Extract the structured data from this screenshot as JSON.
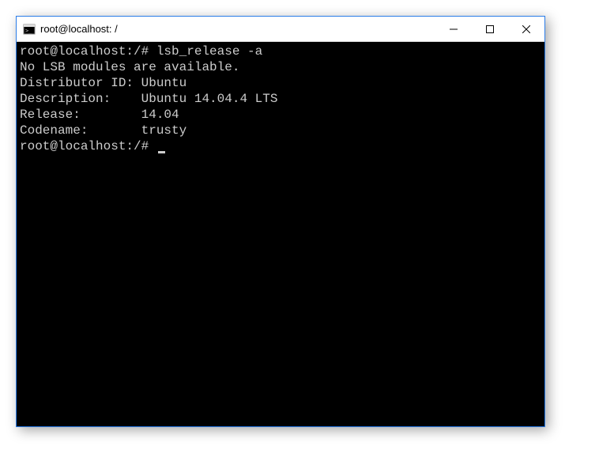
{
  "window": {
    "title": "root@localhost: /"
  },
  "terminal": {
    "lines": [
      "root@localhost:/# lsb_release -a",
      "No LSB modules are available.",
      "Distributor ID: Ubuntu",
      "Description:    Ubuntu 14.04.4 LTS",
      "Release:        14.04",
      "Codename:       trusty",
      "root@localhost:/# "
    ]
  }
}
